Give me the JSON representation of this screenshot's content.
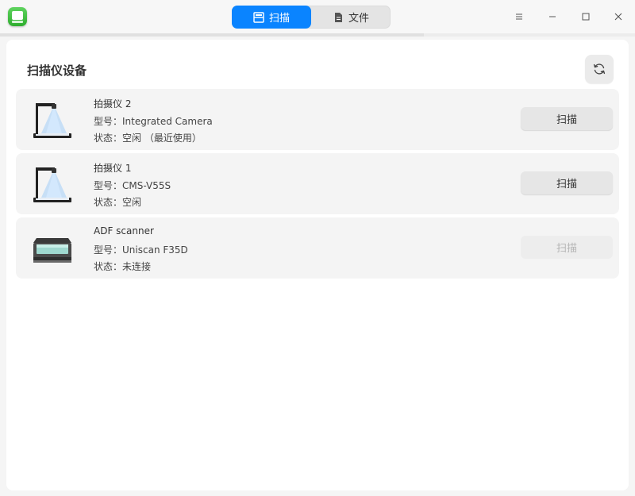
{
  "titlebar": {
    "tabs": [
      {
        "label": "扫描",
        "active": true,
        "icon": "scan-icon"
      },
      {
        "label": "文件",
        "active": false,
        "icon": "file-icon"
      }
    ],
    "controls": [
      "menu-icon",
      "minimize-icon",
      "maximize-icon",
      "close-icon"
    ]
  },
  "page": {
    "title": "扫描仪设备"
  },
  "devices": [
    {
      "name": "拍摄仪 2",
      "model_label": "型号：",
      "model": "Integrated Camera",
      "status_label": "状态：",
      "status": "空闲 （最近使用）",
      "icon": "document-camera-icon",
      "button": "扫描",
      "enabled": true
    },
    {
      "name": "拍摄仪 1",
      "model_label": "型号：",
      "model": "CMS-V55S",
      "status_label": "状态：",
      "status": "空闲",
      "icon": "document-camera-icon",
      "button": "扫描",
      "enabled": true
    },
    {
      "name": "ADF scanner",
      "model_label": "型号：",
      "model": "Uniscan F35D",
      "status_label": "状态：",
      "status": "未连接",
      "icon": "flatbed-scanner-icon",
      "button": "扫描",
      "enabled": false
    }
  ],
  "colors": {
    "accent": "#0a84ff",
    "card_bg": "#f4f4f4",
    "disabled_text": "#b5b5b5"
  }
}
